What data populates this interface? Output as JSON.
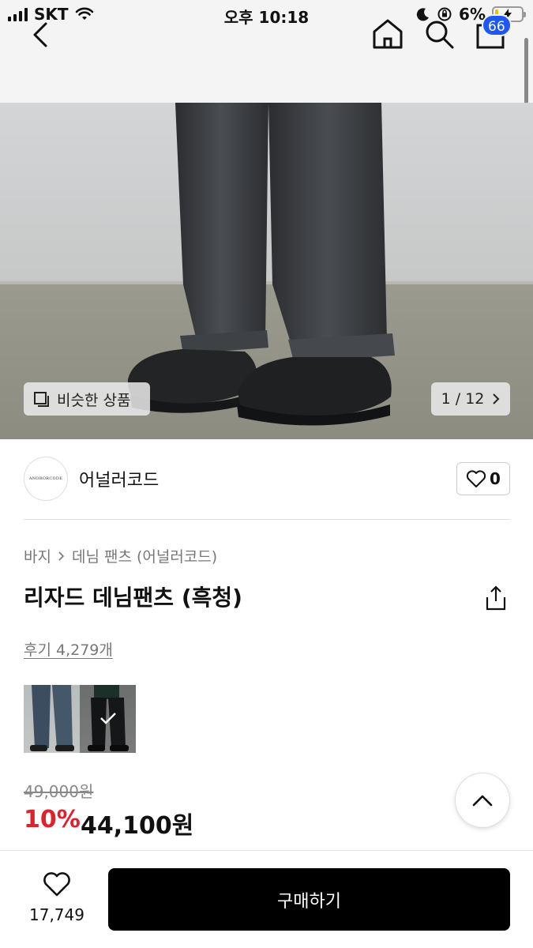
{
  "status_bar": {
    "carrier": "SKT",
    "time": "오후 10:18",
    "battery_percent": "6%"
  },
  "nav": {
    "cart_count": "66",
    "icons": [
      "back-icon",
      "home-icon",
      "search-icon",
      "cart-icon"
    ]
  },
  "hero": {
    "similar_label": "비슷한 상품",
    "pager": "1 / 12"
  },
  "brand": {
    "logo_text": "ANORORCODE",
    "name": "어널러코드",
    "like_count": "0"
  },
  "product": {
    "breadcrumb": [
      "바지",
      "데님 팬츠 (어널러코드)"
    ],
    "title": "리자드 데님팬츠 (흑청)",
    "reviews": "후기 4,279개",
    "original_price": "49,000원",
    "discount": "10%",
    "price": "44,100원"
  },
  "bottom": {
    "wish_count": "17,749",
    "buy_label": "구매하기"
  },
  "colors": {
    "accent_badge": "#1f57f5",
    "discount_red": "#e0202b",
    "buy_button": "#000000"
  }
}
